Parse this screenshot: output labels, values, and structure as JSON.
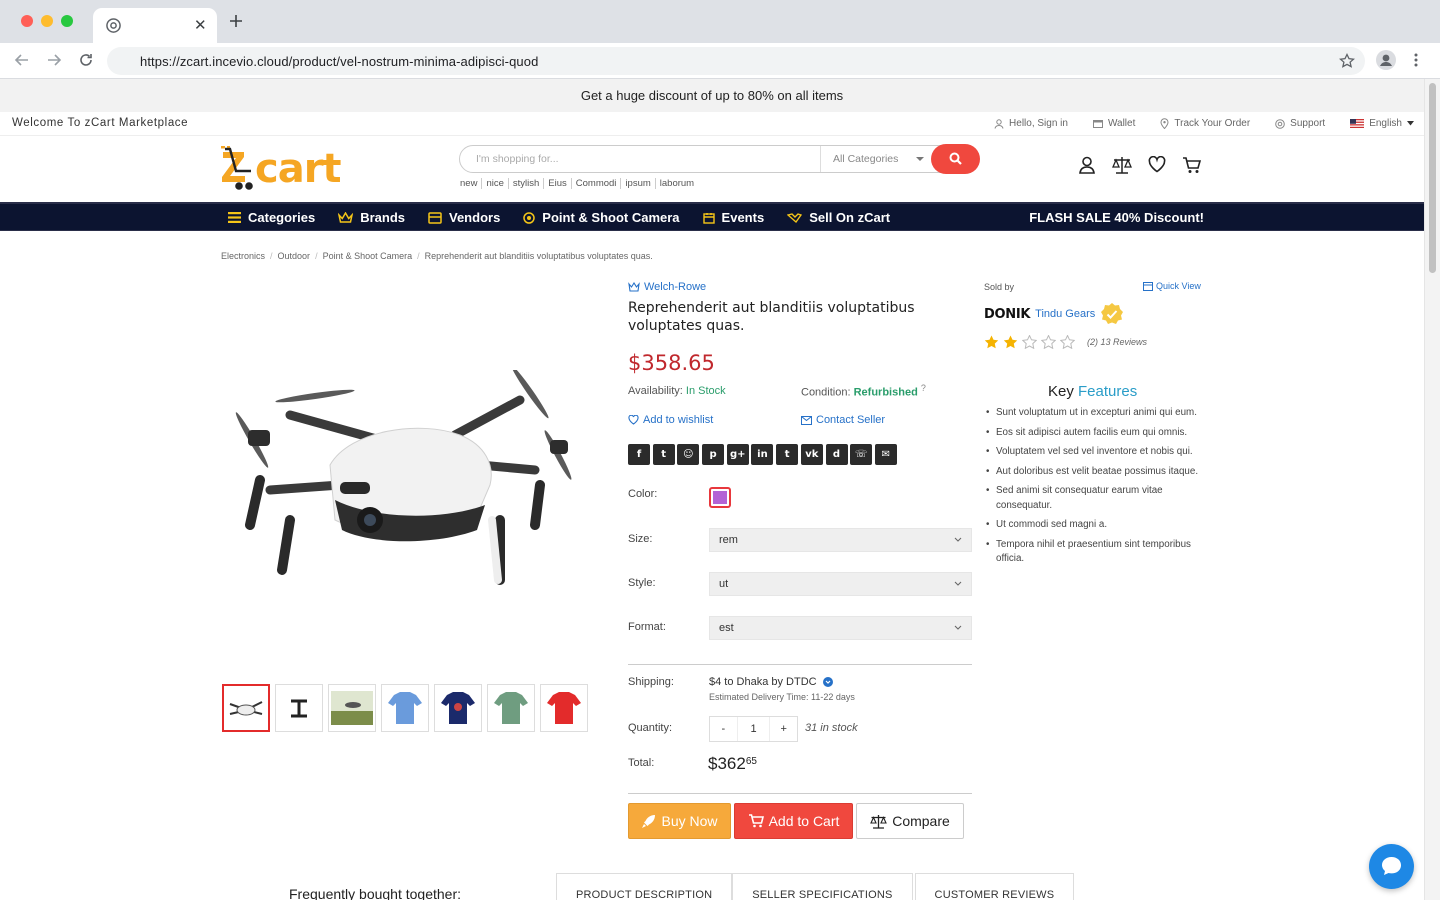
{
  "browser": {
    "url": "https://zcart.incevio.cloud/product/vel-nostrum-minima-adipisci-quod",
    "traffic_colors": [
      "#ff5f57",
      "#febc2e",
      "#28c840"
    ]
  },
  "promo": {
    "text": "Get a huge discount of up to 80% on all items"
  },
  "topbar": {
    "welcome": "Welcome To zCart Marketplace",
    "links": {
      "signin": "Hello, Sign in",
      "wallet": "Wallet",
      "track": "Track Your Order",
      "support": "Support",
      "language": "English"
    }
  },
  "header": {
    "logo_text": "zcart",
    "search_placeholder": "I'm shopping for...",
    "category": "All Categories",
    "tags": [
      "new",
      "nice",
      "stylish",
      "Eius",
      "Commodi",
      "ipsum",
      "laborum"
    ]
  },
  "nav": {
    "items": [
      "Categories",
      "Brands",
      "Vendors",
      "Point & Shoot Camera",
      "Events",
      "Sell On zCart"
    ],
    "flash": "FLASH SALE 40% Discount!"
  },
  "breadcrumb": [
    "Electronics",
    "Outdoor",
    "Point & Shoot Camera",
    "Reprehenderit aut blanditiis voluptatibus voluptates quas."
  ],
  "product": {
    "brand": "Welch-Rowe",
    "title": "Reprehenderit aut blanditiis voluptatibus voluptates quas.",
    "price": "$358.65",
    "availability_label": "Availability:",
    "availability": "In Stock",
    "condition_label": "Condition:",
    "condition": "Refurbished",
    "condition_help": "?",
    "wishlist": "Add to wishlist",
    "contact": "Contact Seller",
    "share_icons": [
      "facebook-icon",
      "twitter-icon",
      "reddit-icon",
      "pinterest-icon",
      "google-plus-icon",
      "linkedin-icon",
      "tumblr-icon",
      "vk-icon",
      "digg-icon",
      "whatsapp-icon",
      "email-icon"
    ],
    "color_label": "Color:",
    "color_value": "#b364d5",
    "size_label": "Size:",
    "size": "rem",
    "style_label": "Style:",
    "style": "ut",
    "format_label": "Format:",
    "format": "est",
    "shipping_label": "Shipping:",
    "shipping": "$4 to Dhaka by DTDC",
    "delivery": "Estimated Delivery Time: 11-22 days",
    "quantity_label": "Quantity:",
    "qty_minus": "-",
    "quantity": "1",
    "qty_plus": "+",
    "stock": "31 in stock",
    "total_label": "Total:",
    "total_main": "$362",
    "total_cents": "65",
    "buy_now": "Buy Now",
    "add_to_cart": "Add to Cart",
    "compare": "Compare"
  },
  "seller": {
    "sold_by": "Sold by",
    "quick_view": "Quick View",
    "logo_text": "DONIK",
    "name": "Tindu Gears",
    "rating": 2,
    "rating_max": 5,
    "reviews": "(2) 13 Reviews"
  },
  "features": {
    "title_plain": "Key ",
    "title_highlight": "Features",
    "items": [
      "Sunt voluptatum ut in excepturi animi qui eum.",
      "Eos sit adipisci autem facilis eum qui omnis.",
      "Voluptatem vel sed vel inventore et nobis qui.",
      "Aut doloribus est velit beatae possimus itaque.",
      "Sed animi sit consequatur earum vitae consequatur.",
      "Ut commodi sed magni a.",
      "Tempora nihil et praesentium sint temporibus officia."
    ]
  },
  "bottom": {
    "fbt": "Frequently bought together:",
    "tabs": [
      "PRODUCT DESCRIPTION",
      "SELLER SPECIFICATIONS",
      "CUSTOMER REVIEWS"
    ]
  },
  "colors": {
    "accent_red": "#f0483e",
    "nav_bg": "#0c1430",
    "price": "#c0282d",
    "link": "#2671c8",
    "buy_now": "#f6a93b"
  }
}
